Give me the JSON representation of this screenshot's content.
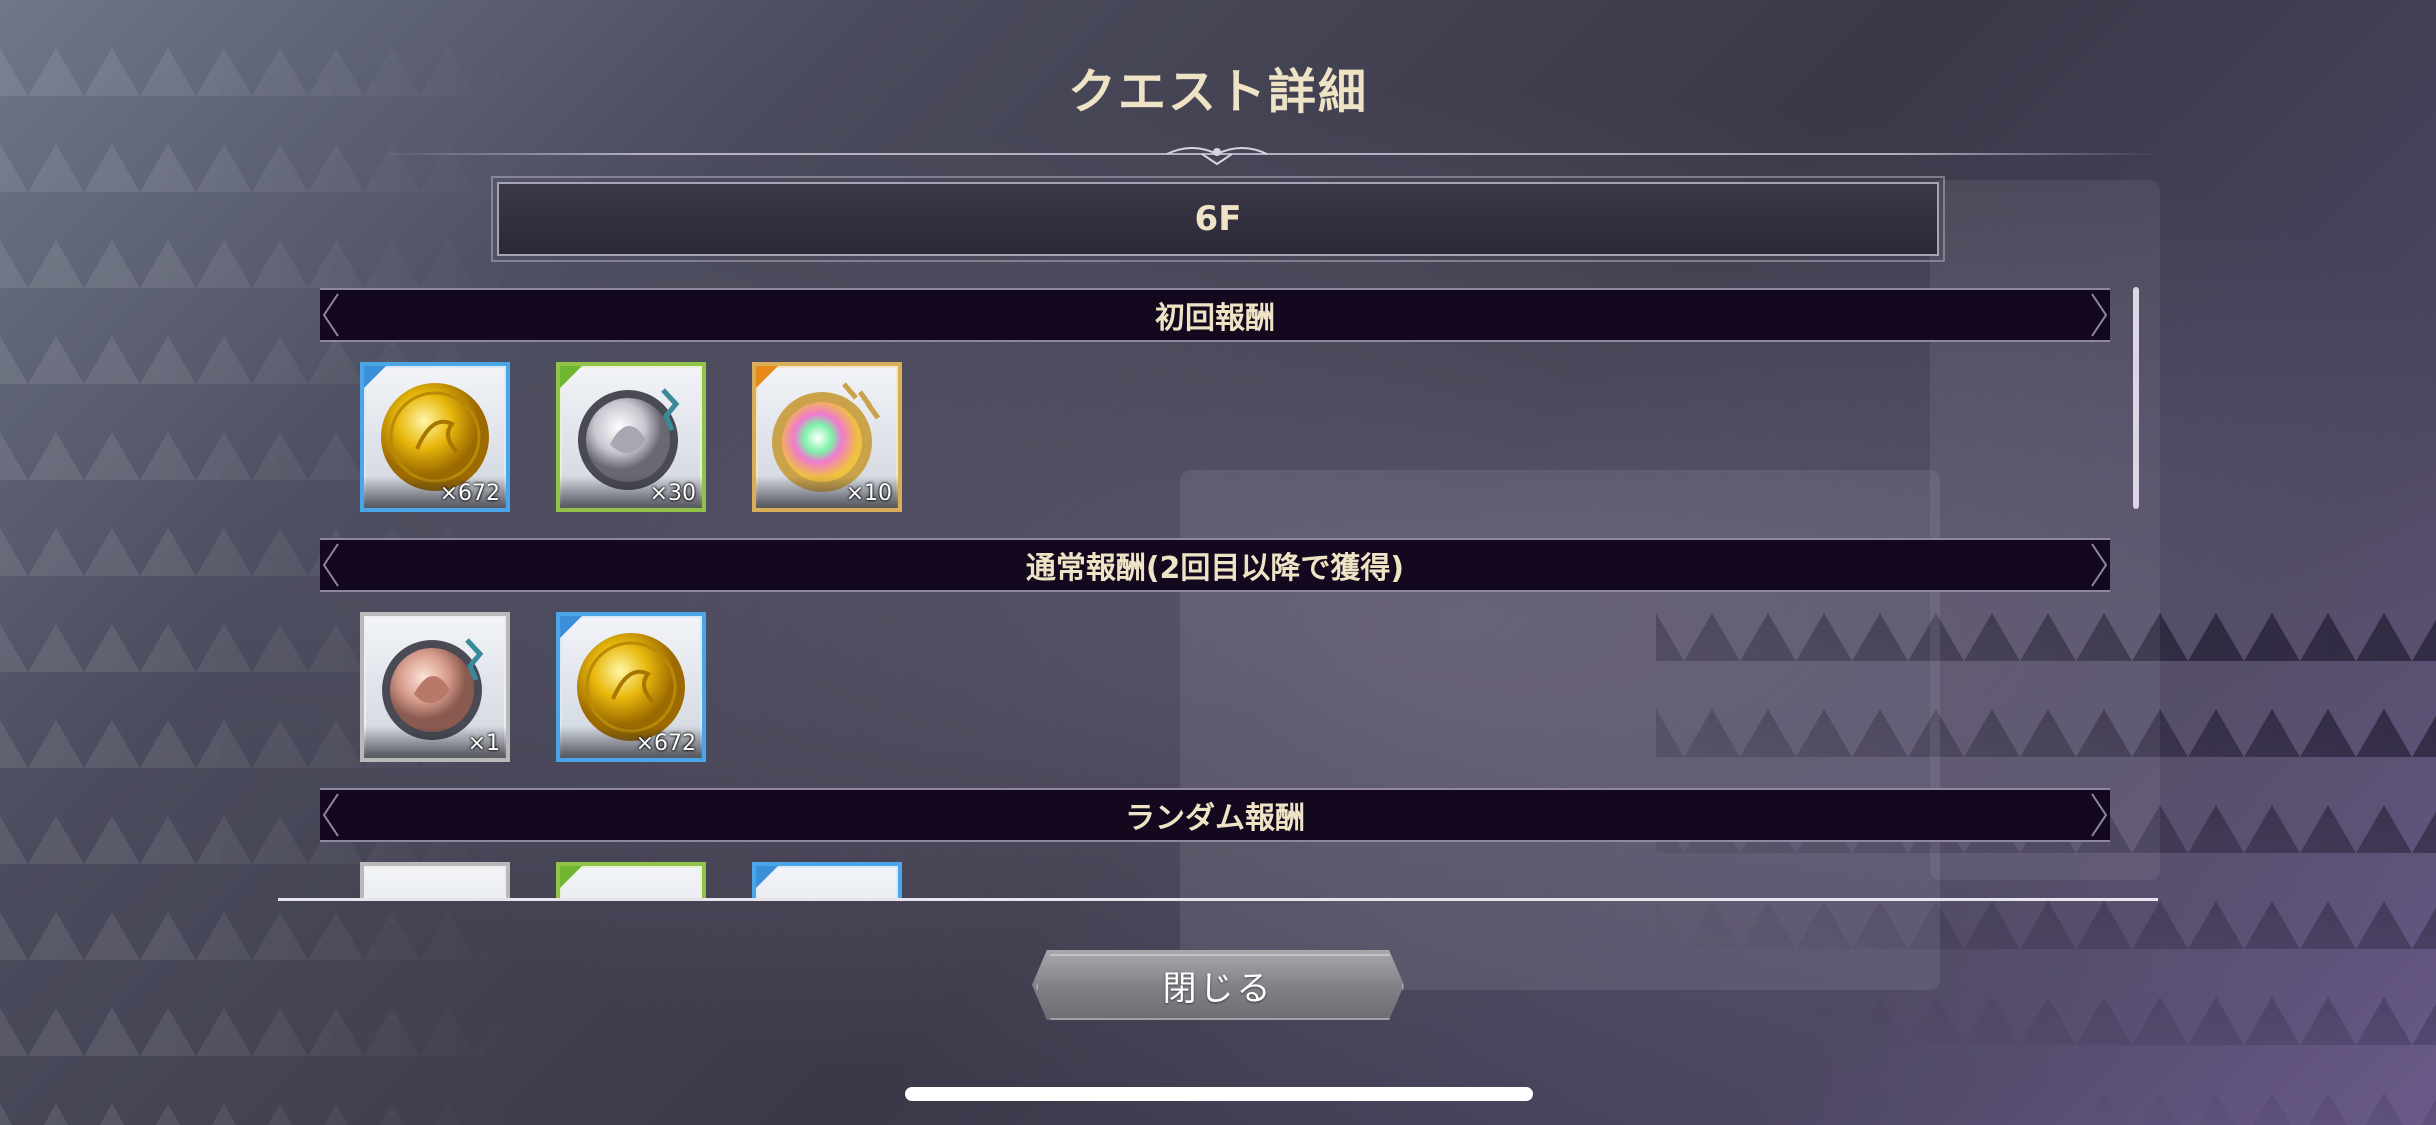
{
  "dialog": {
    "title": "クエスト詳細",
    "floor": "6F",
    "close_label": "閉じる"
  },
  "sections": [
    {
      "header": "初回報酬",
      "items": [
        {
          "icon": "gold-coin-icon",
          "rarity": "blue",
          "qty": "×672"
        },
        {
          "icon": "silver-medal-icon",
          "rarity": "green",
          "qty": "×30"
        },
        {
          "icon": "rainbow-medal-icon",
          "rarity": "gold",
          "qty": "×10"
        }
      ]
    },
    {
      "header": "通常報酬(2回目以降で獲得)",
      "items": [
        {
          "icon": "copper-medal-icon",
          "rarity": "silver",
          "qty": "×1"
        },
        {
          "icon": "gold-coin-icon",
          "rarity": "blue",
          "qty": "×672"
        }
      ]
    },
    {
      "header": "ランダム報酬",
      "items": [
        {
          "icon": "partial-item-icon",
          "rarity": "silver",
          "qty": ""
        },
        {
          "icon": "partial-item-icon",
          "rarity": "green",
          "qty": ""
        },
        {
          "icon": "partial-item-icon",
          "rarity": "blue",
          "qty": ""
        }
      ]
    }
  ],
  "colors": {
    "title_text": "#efe3c6",
    "section_bg": "#14081e",
    "rarity_blue": "#4aa6e6",
    "rarity_green": "#93c24a",
    "rarity_gold": "#d9ae5a",
    "rarity_silver": "#b9b9b9"
  }
}
